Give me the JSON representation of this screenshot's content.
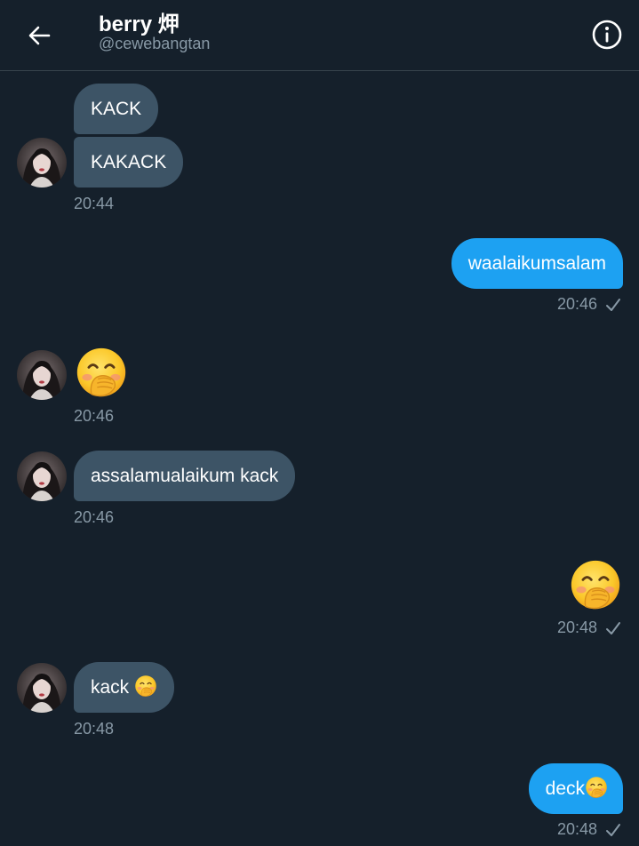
{
  "header": {
    "title": "berry 炠",
    "handle": "@cewebangtan"
  },
  "messages": {
    "m1": {
      "text": "KACK"
    },
    "m2": {
      "text": "KAKACK"
    },
    "t1": "20:44",
    "m3": {
      "text": "waalaikumsalam"
    },
    "t2": "20:46",
    "m4": {
      "emoji": "hand-over-mouth-emoji"
    },
    "t3": "20:46",
    "m5": {
      "text": "assalamualaikum kack"
    },
    "t4": "20:46",
    "m6": {
      "emoji": "hand-over-mouth-emoji"
    },
    "t5": "20:48",
    "m7": {
      "text": "kack"
    },
    "t6": "20:48",
    "m8": {
      "text": "deck"
    },
    "t7": "20:48"
  },
  "colors": {
    "background": "#15202b",
    "incoming_bubble": "#3d5466",
    "outgoing_bubble": "#1da1f2",
    "secondary_text": "#8899a6"
  }
}
